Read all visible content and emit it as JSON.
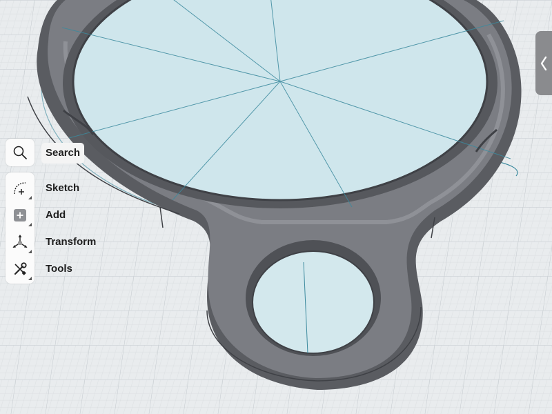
{
  "toolbar": {
    "search_label": "Search",
    "sketch_label": "Sketch",
    "add_label": "Add",
    "transform_label": "Transform",
    "tools_label": "Tools"
  },
  "icons": {
    "search": "magnifier-icon",
    "sketch": "sketch-arc-plus-icon",
    "add": "plus-square-icon",
    "transform": "move-axes-icon",
    "tools": "wrench-screwdriver-icon",
    "side_tab": "chevron-left-icon"
  },
  "colors": {
    "grid_background": "#e9ecee",
    "glass_fill": "#cfe6ec",
    "model_dark": "#5e6066",
    "model_mid": "#7a7c82",
    "sketch_lines": "#3c8a9e",
    "toolbar_bg": "#fbfbfb",
    "side_tab": "#8a8b8e"
  }
}
